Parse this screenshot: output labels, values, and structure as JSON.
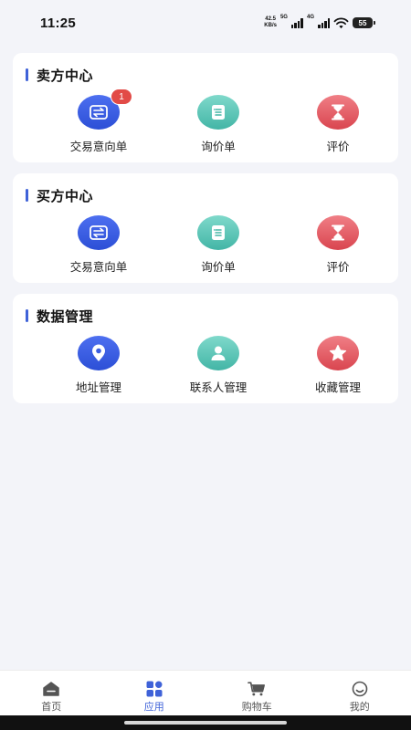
{
  "status_bar": {
    "time": "11:25",
    "net_speed_value": "42.5",
    "net_speed_unit": "KB/s",
    "net_gen_1": "5G",
    "net_gen_2": "4G",
    "battery": "55"
  },
  "sections": [
    {
      "title": "卖方中心",
      "items": [
        {
          "label": "交易意向单",
          "icon": "swap-arrows-icon",
          "color": "#3a5de0",
          "badge": "1"
        },
        {
          "label": "询价单",
          "icon": "list-document-icon",
          "color": "#5cc6b7"
        },
        {
          "label": "评价",
          "icon": "hourglass-icon",
          "color": "#e25a62"
        }
      ]
    },
    {
      "title": "买方中心",
      "items": [
        {
          "label": "交易意向单",
          "icon": "swap-arrows-icon",
          "color": "#3a5de0"
        },
        {
          "label": "询价单",
          "icon": "list-document-icon",
          "color": "#5cc6b7"
        },
        {
          "label": "评价",
          "icon": "hourglass-icon",
          "color": "#e25a62"
        }
      ]
    },
    {
      "title": "数据管理",
      "items": [
        {
          "label": "地址管理",
          "icon": "location-pin-icon",
          "color": "#3a5de0"
        },
        {
          "label": "联系人管理",
          "icon": "person-icon",
          "color": "#5cc6b7"
        },
        {
          "label": "收藏管理",
          "icon": "star-icon",
          "color": "#e25a62"
        }
      ]
    }
  ],
  "bottom_nav": {
    "items": [
      {
        "label": "首页",
        "icon": "home-icon",
        "active": false
      },
      {
        "label": "应用",
        "icon": "apps-grid-icon",
        "active": true
      },
      {
        "label": "购物车",
        "icon": "cart-icon",
        "active": false
      },
      {
        "label": "我的",
        "icon": "smiley-profile-icon",
        "active": false
      }
    ],
    "active_color": "#3f62d8",
    "inactive_color": "#555555"
  },
  "accent_color": "#3f62d8"
}
